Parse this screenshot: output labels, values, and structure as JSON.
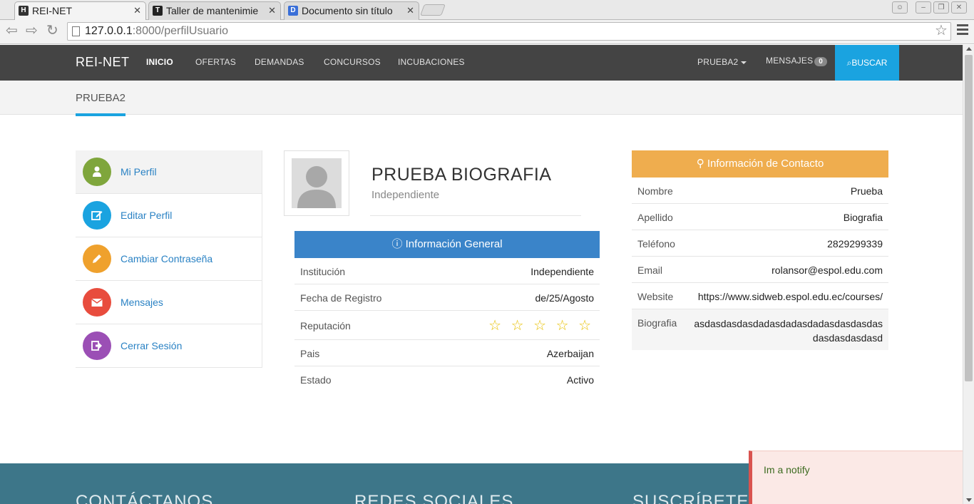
{
  "browser": {
    "tabs": [
      {
        "title": "REI-NET",
        "favicon": "H",
        "favicon_color": "#333333"
      },
      {
        "title": "Taller de mantenimie",
        "favicon": "T",
        "favicon_color": "#222222"
      },
      {
        "title": "Documento sin título",
        "favicon": "D",
        "favicon_color": "#3a6fd8"
      }
    ],
    "url_host": "127.0.0.1",
    "url_rest": ":8000/perfilUsuario"
  },
  "nav": {
    "brand": "REI-NET",
    "links": [
      "INICIO",
      "OFERTAS",
      "DEMANDAS",
      "CONCURSOS",
      "INCUBACIONES"
    ],
    "user": "PRUEBA2",
    "messages_label": "MENSAJES",
    "messages_count": "0",
    "search_label": "BUSCAR"
  },
  "subnav": {
    "tab": "PRUEBA2"
  },
  "sidebar": {
    "items": [
      {
        "label": "Mi Perfil",
        "icon": "user-icon",
        "color": "#7fa63c"
      },
      {
        "label": "Editar Perfil",
        "icon": "edit-icon",
        "color": "#1aa3e0"
      },
      {
        "label": "Cambiar Contraseña",
        "icon": "pencil-icon",
        "color": "#efa12d"
      },
      {
        "label": "Mensajes",
        "icon": "envelope-icon",
        "color": "#e84c3d"
      },
      {
        "label": "Cerrar Sesión",
        "icon": "sign-out-icon",
        "color": "#9b4fb5"
      }
    ]
  },
  "profile": {
    "name": "PRUEBA BIOGRAFIA",
    "role": "Independiente"
  },
  "general": {
    "title": "Información General",
    "rows": [
      {
        "k": "Institución",
        "v": "Independiente"
      },
      {
        "k": "Fecha de Registro",
        "v": "de/25/Agosto"
      },
      {
        "k": "Reputación",
        "v": "☆ ☆ ☆ ☆ ☆"
      },
      {
        "k": "Pais",
        "v": "Azerbaijan"
      },
      {
        "k": "Estado",
        "v": "Activo"
      }
    ]
  },
  "contact": {
    "title": "Información de Contacto",
    "rows": [
      {
        "k": "Nombre",
        "v": "Prueba"
      },
      {
        "k": "Apellido",
        "v": "Biografia"
      },
      {
        "k": "Teléfono",
        "v": "2829299339"
      },
      {
        "k": "Email",
        "v": "rolansor@espol.edu.com"
      },
      {
        "k": "Website",
        "v": "https://www.sidweb.espol.edu.ec/courses/"
      },
      {
        "k": "Biografia",
        "v": "asdasdasdasdadasdadasdadasdasdasdasdasdasdasdasd"
      }
    ]
  },
  "footer": {
    "headings": [
      "CONTÁCTANOS",
      "REDES SOCIALES",
      "SUSCRÍBETE"
    ]
  },
  "notify": {
    "text": "Im a notify"
  }
}
